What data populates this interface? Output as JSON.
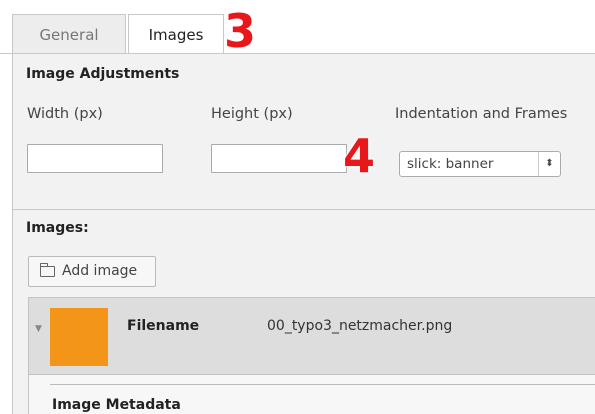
{
  "tabs": [
    {
      "label": "General",
      "active": false
    },
    {
      "label": "Images",
      "active": true
    }
  ],
  "annotations": {
    "tab_marker": "3",
    "select_marker": "4",
    "color": "#e8171a"
  },
  "adjustments": {
    "title": "Image Adjustments",
    "width_label": "Width (px)",
    "width_value": "",
    "height_label": "Height (px)",
    "height_value": "",
    "indentation_label": "Indentation and Frames",
    "indentation_selected": "slick: banner"
  },
  "images": {
    "title": "Images:",
    "add_button": "Add image",
    "file": {
      "thumbnail_color": "#f39519",
      "filename_label": "Filename",
      "filename_value": "00_typo3_netzmacher.png"
    },
    "metadata_title": "Image Metadata"
  }
}
